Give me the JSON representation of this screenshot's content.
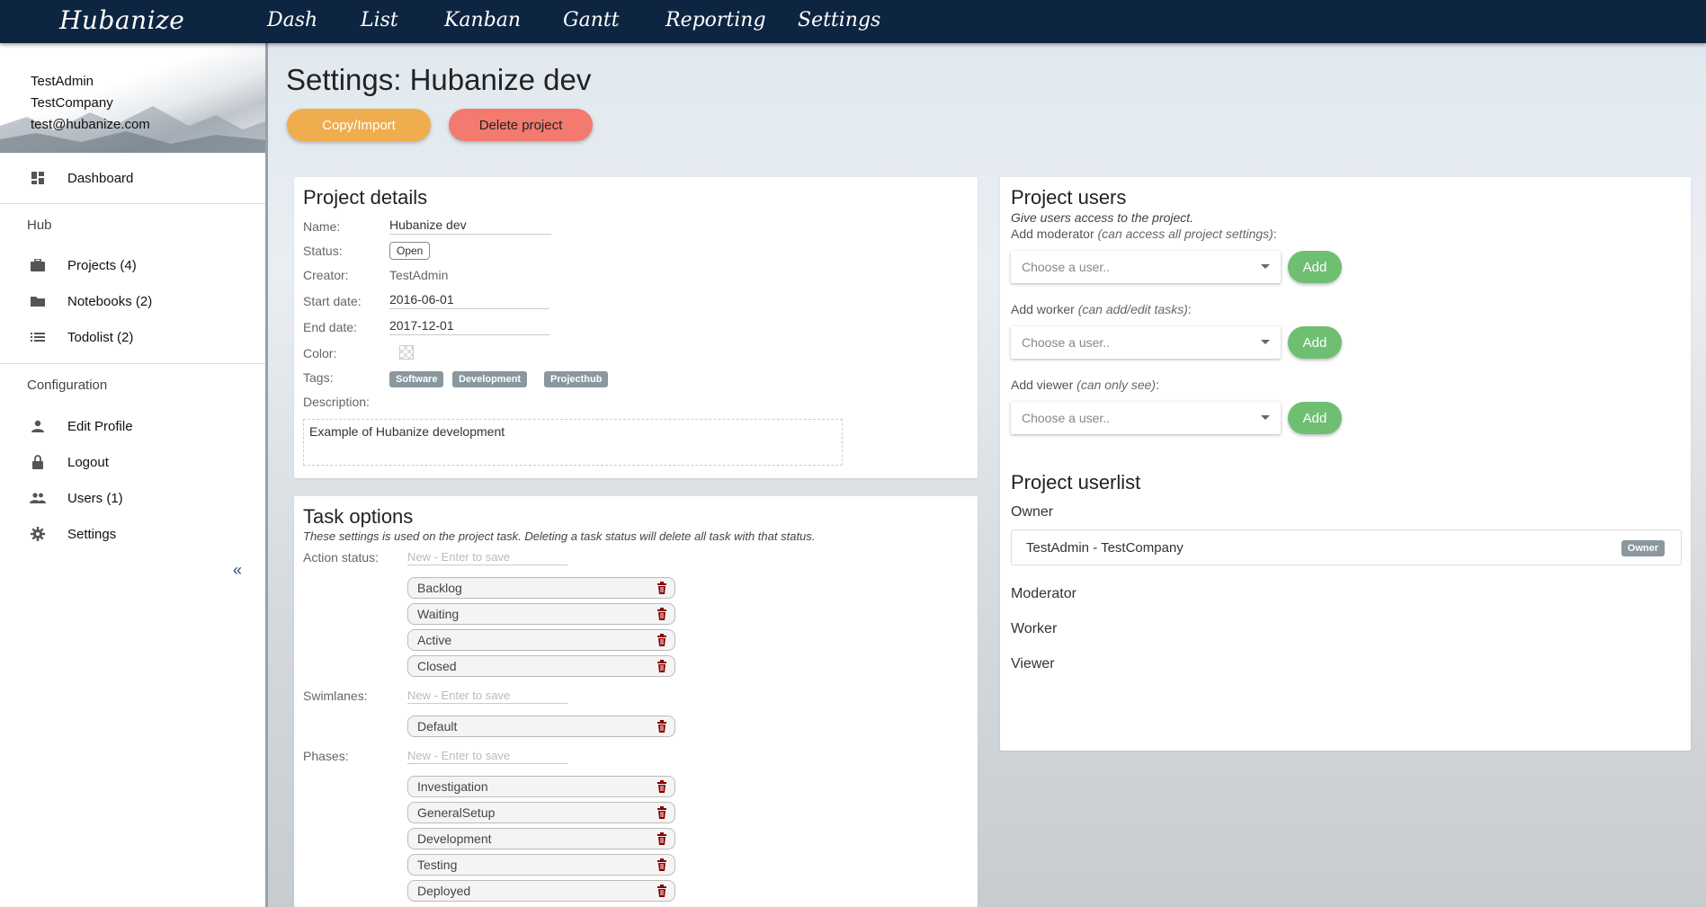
{
  "brand": "Hubanize",
  "nav": {
    "dash": "Dash",
    "list": "List",
    "kanban": "Kanban",
    "gantt": "Gantt",
    "reporting": "Reporting",
    "settings": "Settings"
  },
  "sidebar": {
    "user_name": "TestAdmin",
    "company": "TestCompany",
    "email": "test@hubanize.com",
    "dashboard": "Dashboard",
    "hub_section": "Hub",
    "projects": "Projects (4)",
    "notebooks": "Notebooks (2)",
    "todolist": "Todolist (2)",
    "config_section": "Configuration",
    "edit_profile": "Edit Profile",
    "logout": "Logout",
    "users": "Users (1)",
    "settings": "Settings",
    "collapse": "«"
  },
  "page": {
    "title": "Settings: Hubanize dev",
    "copy_import": "Copy/Import",
    "delete_project": "Delete project"
  },
  "project_details": {
    "heading": "Project details",
    "name_label": "Name:",
    "name_value": "Hubanize dev",
    "status_label": "Status:",
    "status_value": "Open",
    "creator_label": "Creator:",
    "creator_value": "TestAdmin",
    "start_label": "Start date:",
    "start_value": "2016-06-01",
    "end_label": "End date:",
    "end_value": "2017-12-01",
    "color_label": "Color:",
    "tags_label": "Tags:",
    "tags": [
      "Software",
      "Development",
      "Projecthub"
    ],
    "description_label": "Description:",
    "description_value": "Example of Hubanize development"
  },
  "task_options": {
    "heading": "Task options",
    "note": "These settings is used on the project task. Deleting a task status will delete all task with that status.",
    "new_placeholder": "New - Enter to save",
    "action_label": "Action status:",
    "action_items": [
      "Backlog",
      "Waiting",
      "Active",
      "Closed"
    ],
    "swimlanes_label": "Swimlanes:",
    "swimlanes_items": [
      "Default"
    ],
    "phases_label": "Phases:",
    "phases_items": [
      "Investigation",
      "GeneralSetup",
      "Development",
      "Testing",
      "Deployed"
    ]
  },
  "project_users": {
    "heading": "Project users",
    "subtitle": "Give users access to the project.",
    "moderator_label": "Add moderator",
    "moderator_hint": "(can access all project settings)",
    "worker_label": "Add worker",
    "worker_hint": "(can add/edit tasks)",
    "viewer_label": "Add viewer",
    "viewer_hint": "(can only see)",
    "choose_placeholder": "Choose a user..",
    "add": "Add",
    "colon": ":"
  },
  "userlist": {
    "heading": "Project userlist",
    "owner_heading": "Owner",
    "owner_entry": "TestAdmin - TestCompany",
    "owner_badge": "Owner",
    "moderator_heading": "Moderator",
    "worker_heading": "Worker",
    "viewer_heading": "Viewer"
  },
  "colors": {
    "nav_bg": "#0d2541",
    "copy_btn": "#f0ad4e",
    "delete_btn": "#f27a6e",
    "add_btn": "#6fbf73",
    "tag_bg": "#8a979e",
    "trash": "#8b0000"
  }
}
